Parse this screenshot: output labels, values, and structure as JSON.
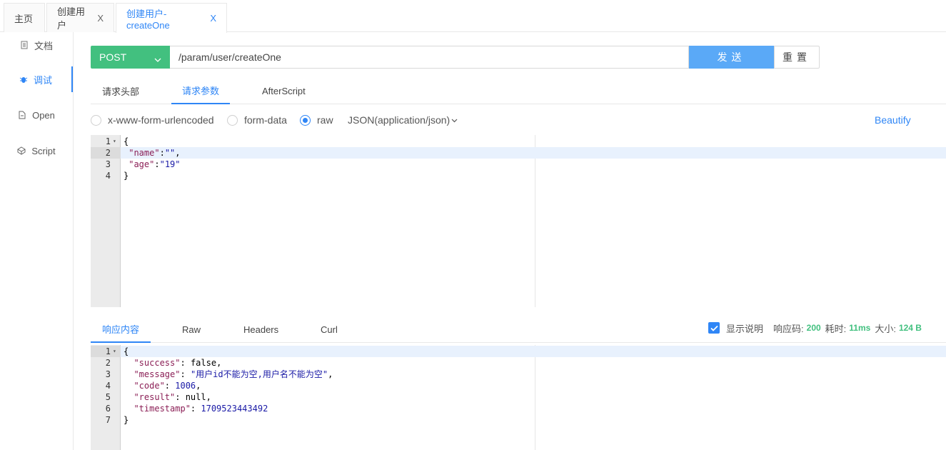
{
  "tabs": [
    {
      "label": "主页",
      "closable": false
    },
    {
      "label": "创建用户",
      "closable": true
    },
    {
      "label": "创建用户-createOne",
      "closable": true,
      "active": true
    }
  ],
  "close_glyph": "X",
  "sidebar": {
    "items": [
      {
        "label": "文档",
        "icon": "document-icon"
      },
      {
        "label": "调试",
        "icon": "bug-icon",
        "active": true
      },
      {
        "label": "Open",
        "icon": "file-icon"
      },
      {
        "label": "Script",
        "icon": "code-icon"
      }
    ]
  },
  "request": {
    "method": "POST",
    "url": "/param/user/createOne",
    "send_label": "发送",
    "reset_label": "重置"
  },
  "request_tabs": [
    {
      "label": "请求头部"
    },
    {
      "label": "请求参数",
      "active": true
    },
    {
      "label": "AfterScript"
    }
  ],
  "body_types": [
    {
      "label": "x-www-form-urlencoded",
      "checked": false
    },
    {
      "label": "form-data",
      "checked": false
    },
    {
      "label": "raw",
      "checked": true
    }
  ],
  "content_type": "JSON(application/json)",
  "beautify_label": "Beautify",
  "request_body_lines": [
    "{",
    " \"name\":\"\",",
    " \"age\":\"19\"",
    "}"
  ],
  "response_tabs": [
    {
      "label": "响应内容",
      "active": true
    },
    {
      "label": "Raw"
    },
    {
      "label": "Headers"
    },
    {
      "label": "Curl"
    }
  ],
  "response_meta": {
    "show_desc_label": "显示说明",
    "show_desc_checked": true,
    "status_label": "响应码:",
    "status_value": "200",
    "time_label": "耗时:",
    "time_value": "11ms",
    "size_label": "大小:",
    "size_value": "124 B"
  },
  "response_body_lines": [
    "{",
    "  \"success\": false,",
    "  \"message\": \"用户id不能为空,用户名不能为空\",",
    "  \"code\": 1006,",
    "  \"result\": null,",
    "  \"timestamp\": 1709523443492",
    "}"
  ],
  "colors": {
    "accent": "#2f86f6",
    "method_bg": "#42c07f",
    "send_bg": "#5aa9f7",
    "status_green": "#42c07f"
  }
}
